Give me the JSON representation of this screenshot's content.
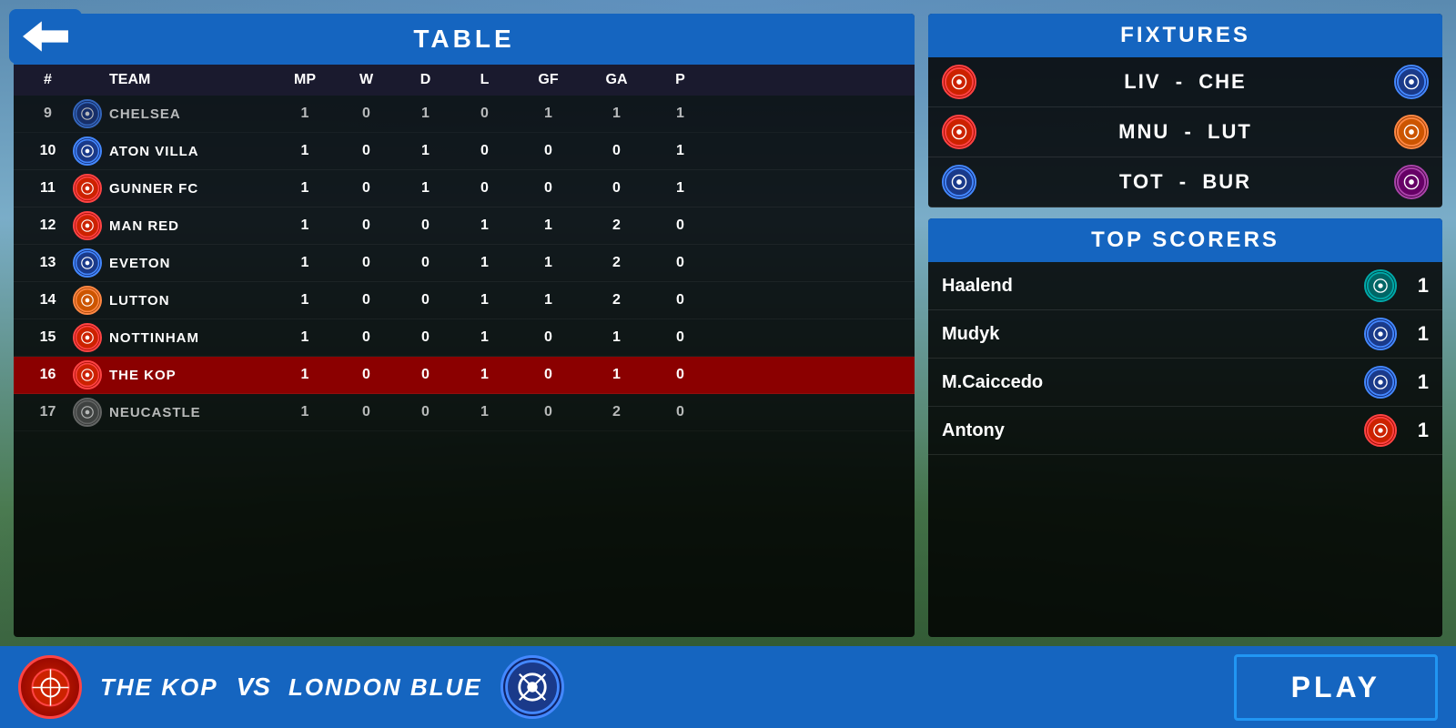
{
  "back_button": {
    "label": "Back"
  },
  "table": {
    "title": "TABLE",
    "columns": [
      "#",
      "TEAM",
      "MP",
      "W",
      "D",
      "L",
      "GF",
      "GA",
      "P"
    ],
    "rows": [
      {
        "num": "9",
        "team": "CHELSEA",
        "mp": 1,
        "w": 0,
        "d": 1,
        "l": 0,
        "gf": 1,
        "ga": 1,
        "p": 1,
        "badge": "blue",
        "partial": true
      },
      {
        "num": "10",
        "team": "ATON VILLA",
        "mp": 1,
        "w": 0,
        "d": 1,
        "l": 0,
        "gf": 0,
        "ga": 0,
        "p": 1,
        "badge": "blue",
        "partial": false
      },
      {
        "num": "11",
        "team": "GUNNER FC",
        "mp": 1,
        "w": 0,
        "d": 1,
        "l": 0,
        "gf": 0,
        "ga": 0,
        "p": 1,
        "badge": "red",
        "partial": false
      },
      {
        "num": "12",
        "team": "MAN RED",
        "mp": 1,
        "w": 0,
        "d": 0,
        "l": 1,
        "gf": 1,
        "ga": 2,
        "p": 0,
        "badge": "red",
        "partial": false
      },
      {
        "num": "13",
        "team": "EVETON",
        "mp": 1,
        "w": 0,
        "d": 0,
        "l": 1,
        "gf": 1,
        "ga": 2,
        "p": 0,
        "badge": "blue",
        "partial": false
      },
      {
        "num": "14",
        "team": "LUTTON",
        "mp": 1,
        "w": 0,
        "d": 0,
        "l": 1,
        "gf": 1,
        "ga": 2,
        "p": 0,
        "badge": "orange",
        "partial": false
      },
      {
        "num": "15",
        "team": "NOTTINHAM",
        "mp": 1,
        "w": 0,
        "d": 0,
        "l": 1,
        "gf": 0,
        "ga": 1,
        "p": 0,
        "badge": "red",
        "partial": false
      },
      {
        "num": "16",
        "team": "THE KOP",
        "mp": 1,
        "w": 0,
        "d": 0,
        "l": 1,
        "gf": 0,
        "ga": 1,
        "p": 0,
        "badge": "red",
        "highlighted": true
      },
      {
        "num": "17",
        "team": "NEUCASTLE",
        "mp": 1,
        "w": 0,
        "d": 0,
        "l": 1,
        "gf": 0,
        "ga": 2,
        "p": 0,
        "badge": "gray",
        "partial": true
      }
    ]
  },
  "fixtures": {
    "title": "FIXTURES",
    "matches": [
      {
        "home": "LIV",
        "away": "CHE",
        "home_badge": "red",
        "away_badge": "blue"
      },
      {
        "home": "MNU",
        "away": "LUT",
        "home_badge": "red",
        "away_badge": "orange"
      },
      {
        "home": "TOT",
        "away": "BUR",
        "home_badge": "blue",
        "away_badge": "purple"
      }
    ]
  },
  "top_scorers": {
    "title": "TOP SCORERS",
    "scorers": [
      {
        "name": "Haalend",
        "goals": 1,
        "badge": "teal"
      },
      {
        "name": "Mudyk",
        "goals": 1,
        "badge": "blue"
      },
      {
        "name": "M.Caiccedo",
        "goals": 1,
        "badge": "blue"
      },
      {
        "name": "Antony",
        "goals": 1,
        "badge": "red"
      }
    ]
  },
  "match": {
    "home_team": "THE KOP",
    "vs": "VS",
    "away_team": "LONDON BLUE"
  },
  "play_button": "PLAY"
}
